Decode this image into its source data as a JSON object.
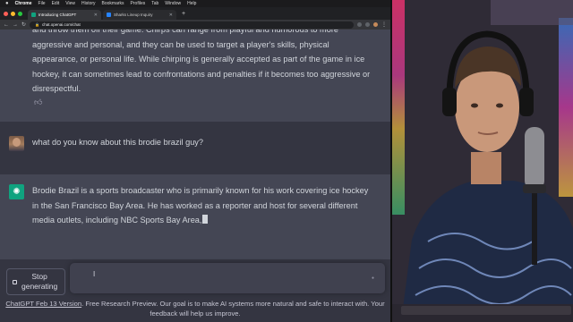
{
  "menubar": {
    "apple": "",
    "app": "Chrome",
    "items": [
      "File",
      "Edit",
      "View",
      "History",
      "Bookmarks",
      "Profiles",
      "Tab",
      "Window",
      "Help"
    ]
  },
  "tabs": [
    {
      "title": "Introducing ChatGPT",
      "active": true
    },
    {
      "title": "Sharks Lineup Inquiry",
      "active": false
    }
  ],
  "address": {
    "url": "chat.openai.com/chat"
  },
  "messages": {
    "assistant_prev": "and throw them off their game. Chirps can range from playful and humorous to more aggressive and personal, and they can be used to target a player's skills, physical appearance, or personal life. While chirping is generally accepted as part of the game in ice hockey, it can sometimes lead to confrontations and penalties if it becomes too aggressive or disrespectful.",
    "user": "what do you know about this brodie brazil guy?",
    "assistant_current": "Brodie Brazil is a sports broadcaster who is primarily known for his work covering ice hockey in the San Francisco Bay Area. He has worked as a reporter and host for several different media outlets, including NBC Sports Bay Area,"
  },
  "composer": {
    "stop_label_line1": "Stop",
    "stop_label_line2": "generating"
  },
  "footer": {
    "link": "ChatGPT Feb 13 Version",
    "text": ". Free Research Preview. Our goal is to make AI systems more natural and safe to interact with. Your feedback will help us improve."
  },
  "colors": {
    "chat_bg": "#343541",
    "assistant_bg": "#444654",
    "accent": "#10a37f",
    "text": "#d1d5db"
  },
  "icons": {
    "thumbs_up": "thumbs-up-icon",
    "openai": "openai-logo-icon",
    "stop": "stop-icon"
  }
}
